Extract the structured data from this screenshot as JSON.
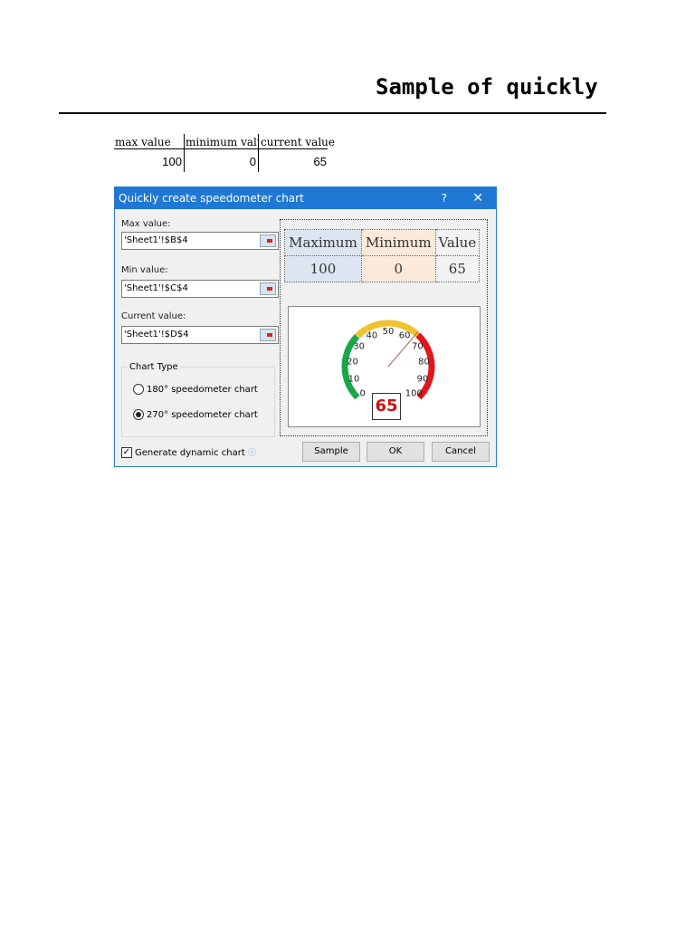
{
  "heading": "Sample of quickly",
  "sheet": {
    "headers": [
      "max value",
      "minimum value",
      "current value"
    ],
    "values": [
      "100",
      "0",
      "65"
    ]
  },
  "dialog": {
    "title": "Quickly create speedometer chart",
    "help": "?",
    "close": "✕",
    "max_label": "Max value:",
    "max_value": "'Sheet1'!$B$4",
    "min_label": "Min value:",
    "min_value": "'Sheet1'!$C$4",
    "cur_label": "Current value:",
    "cur_value": "'Sheet1'!$D$4",
    "chart_type_label": "Chart Type",
    "opt180": "180° speedometer chart",
    "opt270": "270° speedometer chart",
    "selected": "270",
    "dynamic_label": "Generate dynamic chart",
    "dynamic_checked": true,
    "preview": {
      "headers": [
        "Maximum",
        "Minimum",
        "Value"
      ],
      "values": [
        "100",
        "0",
        "65"
      ],
      "colors": [
        "#dce6f1",
        "#fde9d9",
        "#f2f2f2"
      ]
    },
    "gauge": {
      "min": 0,
      "max": 100,
      "value": 65,
      "value_label": "65",
      "ticks": [
        "0",
        "10",
        "20",
        "30",
        "40",
        "50",
        "60",
        "70",
        "80",
        "90",
        "100"
      ],
      "bands": [
        {
          "from": 0,
          "to": 33,
          "color": "#1aa64a"
        },
        {
          "from": 33,
          "to": 66,
          "color": "#f2c12e"
        },
        {
          "from": 66,
          "to": 100,
          "color": "#e0161b"
        }
      ]
    },
    "buttons": {
      "sample": "Sample",
      "ok": "OK",
      "cancel": "Cancel"
    }
  }
}
